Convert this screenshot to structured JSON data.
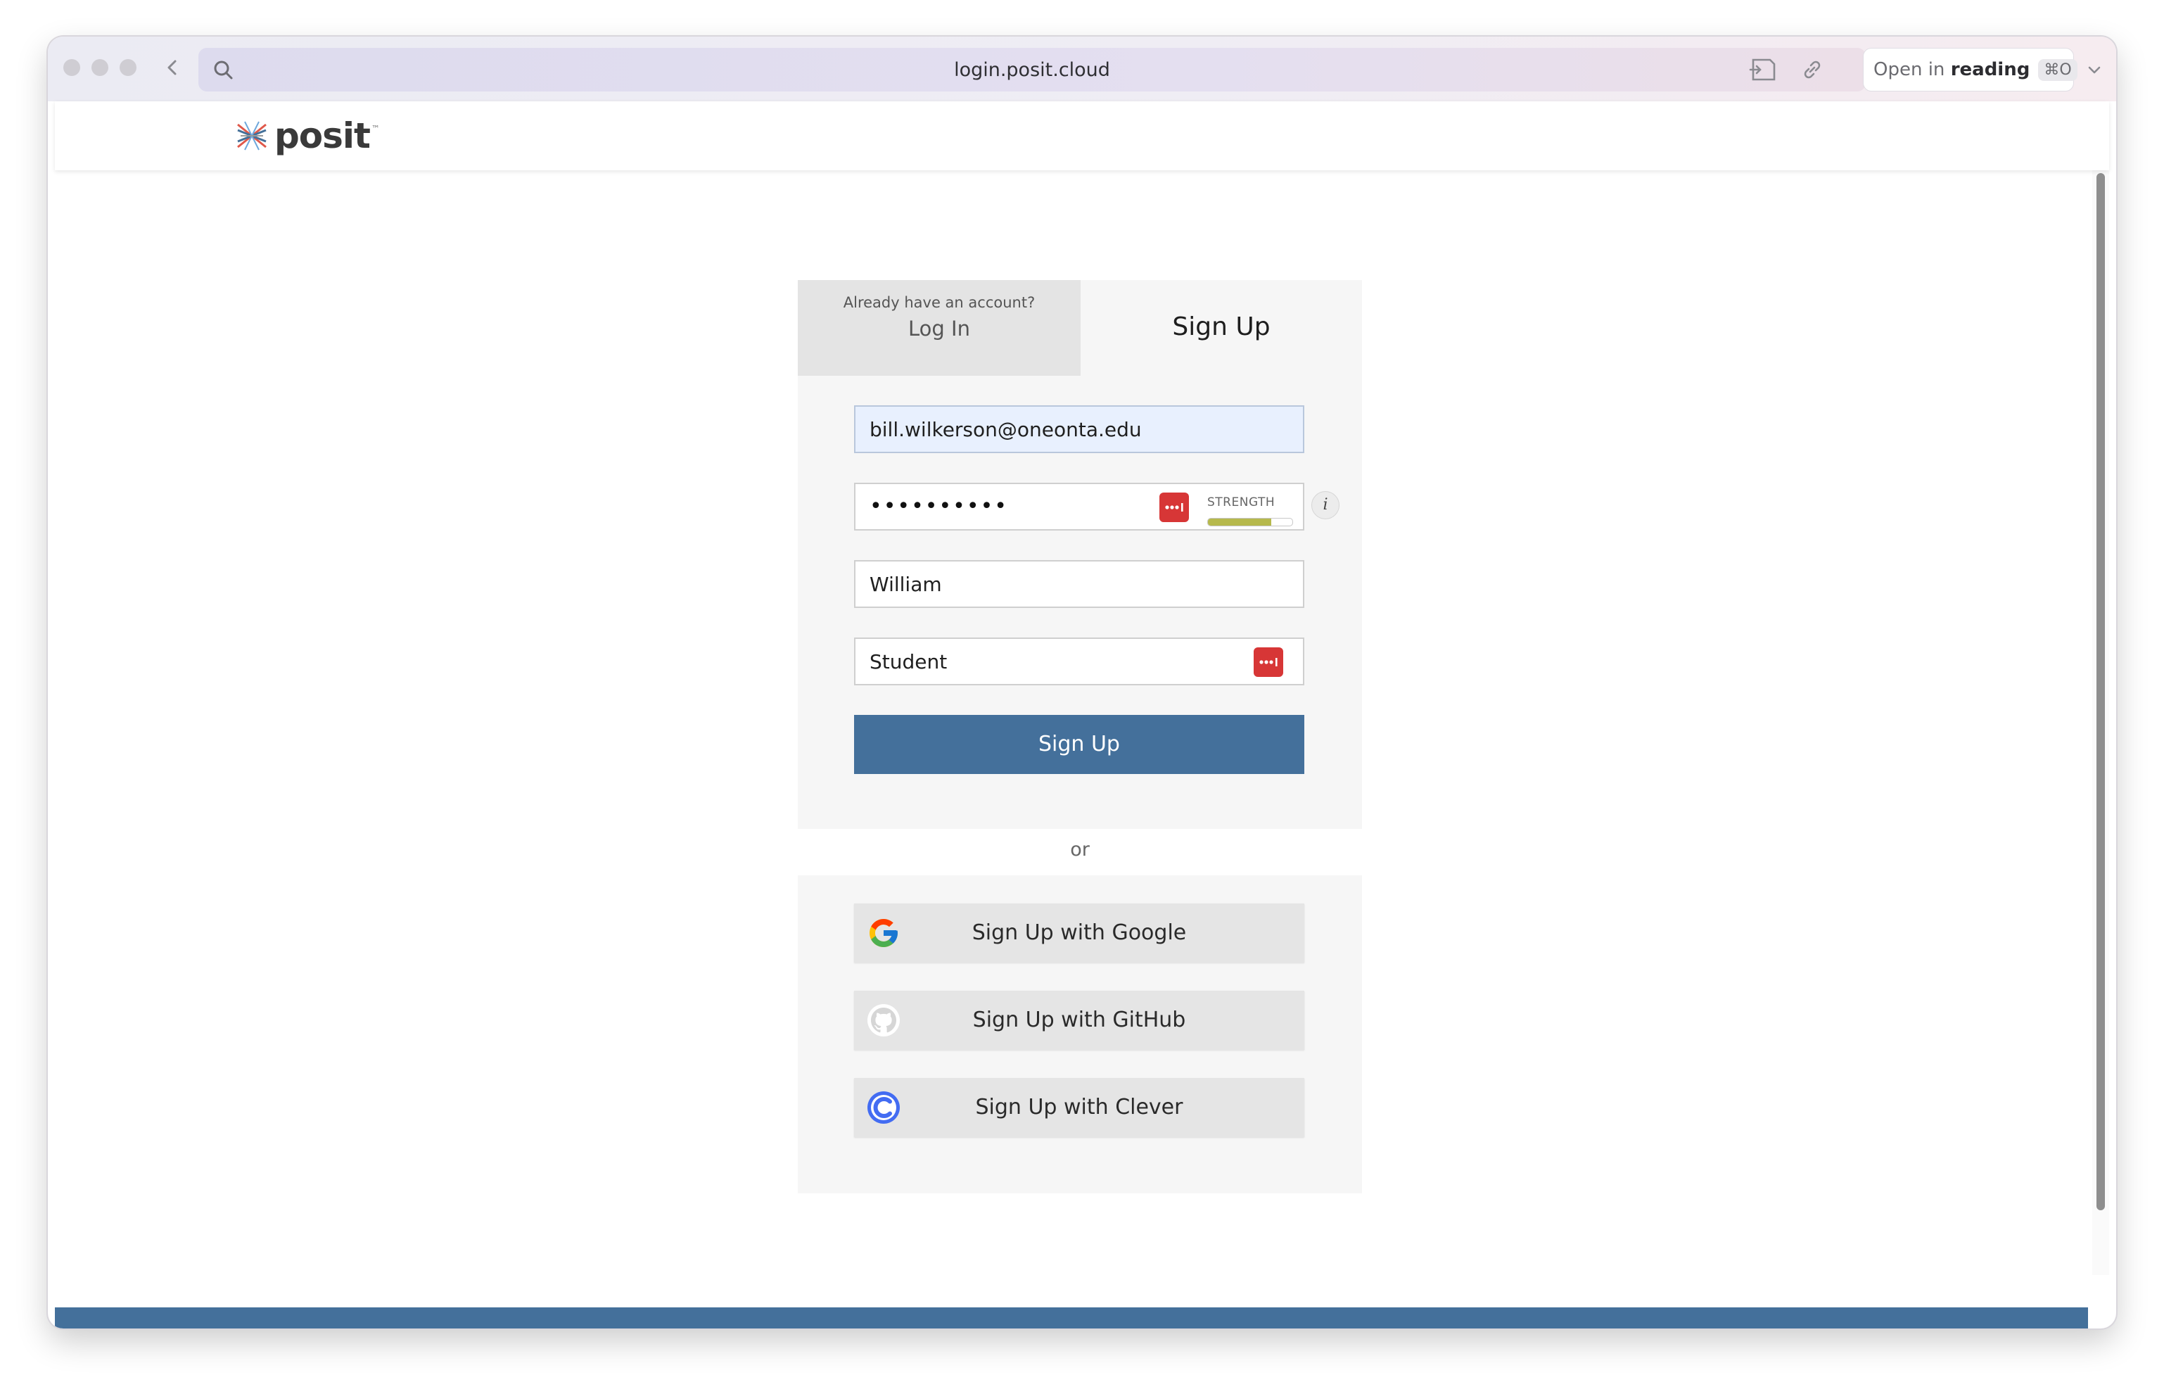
{
  "browser": {
    "url": "login.posit.cloud",
    "reading_prefix": "Open in ",
    "reading_bold": "reading",
    "reading_shortcut": "⌘O"
  },
  "site": {
    "logo_text": "posit",
    "logo_tm": "™"
  },
  "auth": {
    "login_tab_hint": "Already have an account?",
    "login_tab_label": "Log In",
    "signup_tab_label": "Sign Up",
    "email_value": "bill.wilkerson@oneonta.edu",
    "password_mask": "••••••••••",
    "strength_label": "STRENGTH",
    "strength_level": 0.75,
    "first_name_value": "William",
    "last_name_value": "Student",
    "info_symbol": "i",
    "signup_button": "Sign Up",
    "or_text": "or"
  },
  "social": [
    {
      "label": "Sign Up with Google",
      "icon": "google-icon"
    },
    {
      "label": "Sign Up with GitHub",
      "icon": "github-icon"
    },
    {
      "label": "Sign Up with Clever",
      "icon": "clever-icon"
    }
  ],
  "colors": {
    "primary": "#44709b",
    "password_manager": "#d73636",
    "strength": "#b6b94d"
  }
}
